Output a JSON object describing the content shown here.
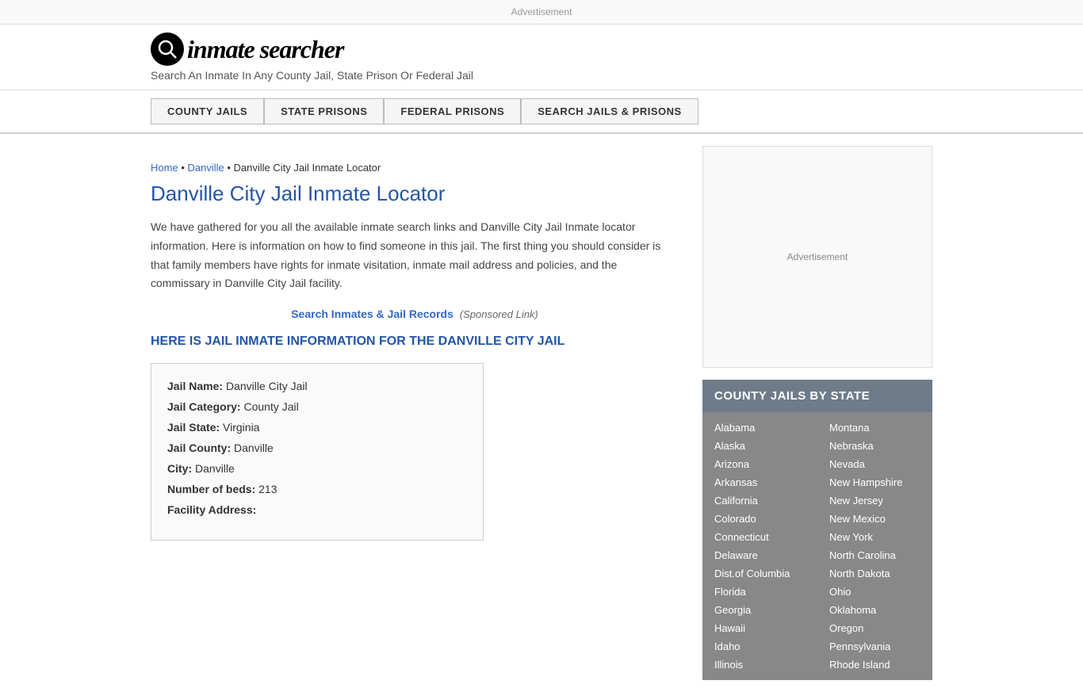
{
  "header": {
    "logo_icon": "🔍",
    "logo_text": "inmate searcher",
    "tagline": "Search An Inmate In Any County Jail, State Prison Or Federal Jail"
  },
  "nav": {
    "buttons": [
      {
        "label": "COUNTY JAILS",
        "id": "county-jails"
      },
      {
        "label": "STATE PRISONS",
        "id": "state-prisons"
      },
      {
        "label": "FEDERAL PRISONS",
        "id": "federal-prisons"
      },
      {
        "label": "SEARCH JAILS & PRISONS",
        "id": "search-jails"
      }
    ]
  },
  "ad_label": "Advertisement",
  "breadcrumb": {
    "home": "Home",
    "city": "Danville",
    "current": "Danville City Jail Inmate Locator"
  },
  "page_title": "Danville City Jail Inmate Locator",
  "description": "We have gathered for you all the available inmate search links and Danville City Jail Inmate locator information. Here is information on how to find someone in this jail. The first thing you should consider is that family members have rights for inmate visitation, inmate mail address and policies, and the commissary in Danville City Jail facility.",
  "sponsored": {
    "link_text": "Search Inmates & Jail Records",
    "label": "(Sponsored Link)"
  },
  "section_heading": "HERE IS JAIL INMATE INFORMATION FOR THE DANVILLE CITY JAIL",
  "info": {
    "jail_name_label": "Jail Name:",
    "jail_name": "Danville City Jail",
    "jail_category_label": "Jail Category:",
    "jail_category": "County Jail",
    "jail_state_label": "Jail State:",
    "jail_state": "Virginia",
    "jail_county_label": "Jail County:",
    "jail_county": "Danville",
    "city_label": "City:",
    "city": "Danville",
    "beds_label": "Number of beds:",
    "beds": "213",
    "address_label": "Facility Address:"
  },
  "sidebar": {
    "ad_label": "Advertisement",
    "state_box_header": "COUNTY JAILS BY STATE",
    "states_left": [
      "Alabama",
      "Alaska",
      "Arizona",
      "Arkansas",
      "California",
      "Colorado",
      "Connecticut",
      "Delaware",
      "Dist.of Columbia",
      "Florida",
      "Georgia",
      "Hawaii",
      "Idaho",
      "Illinois"
    ],
    "states_right": [
      "Montana",
      "Nebraska",
      "Nevada",
      "New Hampshire",
      "New Jersey",
      "New Mexico",
      "New York",
      "North Carolina",
      "North Dakota",
      "Ohio",
      "Oklahoma",
      "Oregon",
      "Pennsylvania",
      "Rhode Island"
    ]
  }
}
